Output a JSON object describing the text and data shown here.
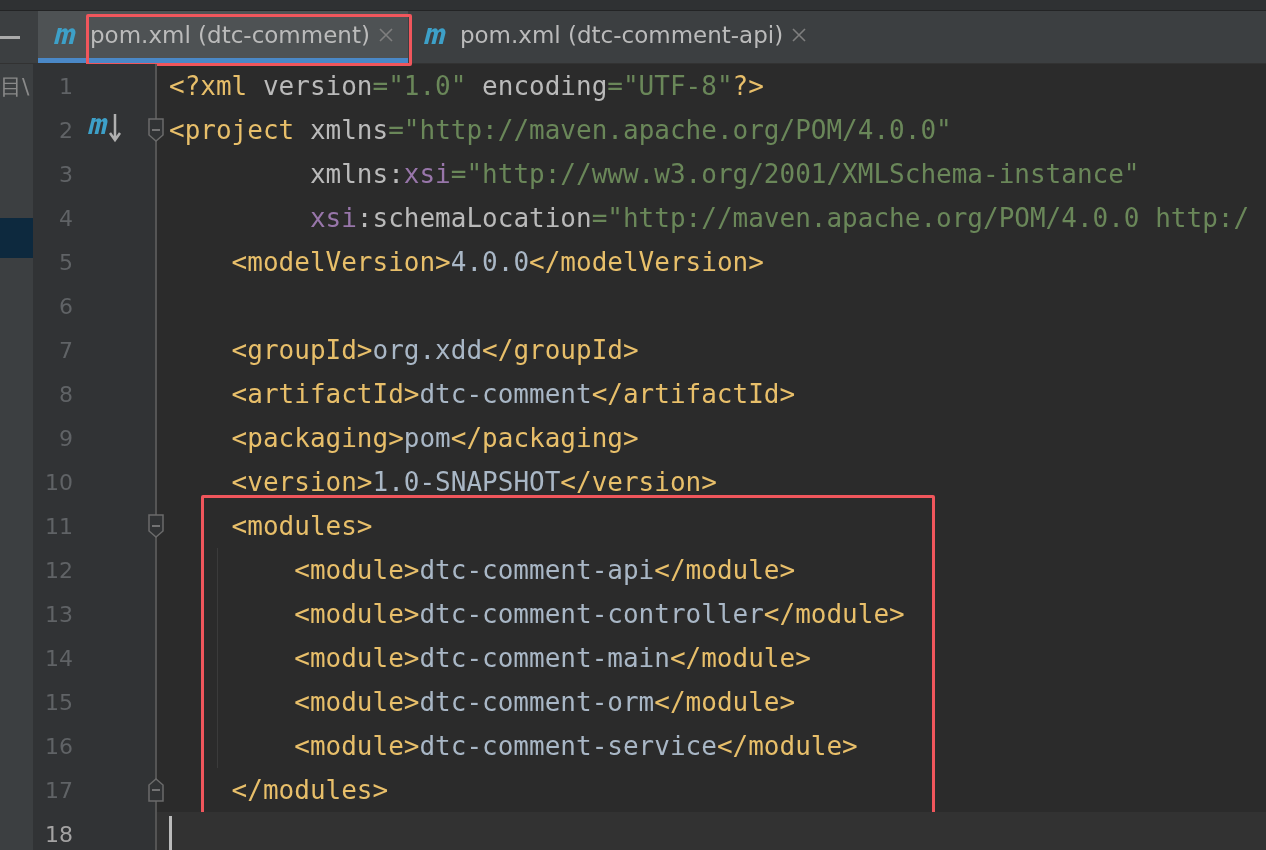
{
  "sidebar": {
    "label": "目\\"
  },
  "tabs": [
    {
      "label": "pom.xml (dtc-comment)",
      "selected": true,
      "highlighted": true
    },
    {
      "label": "pom.xml (dtc-comment-api)",
      "selected": false,
      "highlighted": false
    }
  ],
  "editor": {
    "blocks": [
      {
        "highlighted": false,
        "lines": [
          {
            "number": "1",
            "current": false,
            "tokens": [
              {
                "t": "<?xml ",
                "kind": "tag"
              },
              {
                "t": "version",
                "kind": "attr"
              },
              {
                "t": "=\"1.0\" ",
                "kind": "value"
              },
              {
                "t": "encoding",
                "kind": "attr"
              },
              {
                "t": "=\"UTF-8\"",
                "kind": "value"
              },
              {
                "t": "?>",
                "kind": "tag"
              }
            ]
          },
          {
            "number": "2",
            "current": false,
            "fold_start": true,
            "maven_marker": true,
            "tokens": [
              {
                "t": "<project ",
                "kind": "tag"
              },
              {
                "t": "xmlns",
                "kind": "attr"
              },
              {
                "t": "=\"http://maven.apache.org/POM/4.0.0\"",
                "kind": "value"
              }
            ]
          },
          {
            "number": "3",
            "current": false,
            "tokens": [
              {
                "t": "         xmlns:",
                "kind": "attr"
              },
              {
                "t": "xsi",
                "kind": "ns"
              },
              {
                "t": "=\"http://www.w3.org/2001/XMLSchema-instance\"",
                "kind": "value"
              }
            ]
          },
          {
            "number": "4",
            "current": false,
            "tokens": [
              {
                "t": "         xsi",
                "kind": "ns"
              },
              {
                "t": ":schemaLocation",
                "kind": "attr"
              },
              {
                "t": "=\"http://maven.apache.org/POM/4.0.0 http:/",
                "kind": "value"
              }
            ]
          },
          {
            "number": "5",
            "current": false,
            "tokens": [
              {
                "t": "    <modelVersion>",
                "kind": "tag"
              },
              {
                "t": "4.0.0",
                "kind": "text"
              },
              {
                "t": "</modelVersion>",
                "kind": "tag"
              }
            ]
          },
          {
            "number": "6",
            "current": false
          },
          {
            "number": "7",
            "current": false,
            "tokens": [
              {
                "t": "    <groupId>",
                "kind": "tag"
              },
              {
                "t": "org.xdd",
                "kind": "text"
              },
              {
                "t": "</groupId>",
                "kind": "tag"
              }
            ]
          },
          {
            "number": "8",
            "current": false,
            "tokens": [
              {
                "t": "    <artifactId>",
                "kind": "tag"
              },
              {
                "t": "dtc-comment",
                "kind": "text"
              },
              {
                "t": "</artifactId>",
                "kind": "tag"
              }
            ]
          },
          {
            "number": "9",
            "current": false,
            "tokens": [
              {
                "t": "    <packaging>",
                "kind": "tag"
              },
              {
                "t": "pom",
                "kind": "text"
              },
              {
                "t": "</packaging>",
                "kind": "tag"
              }
            ]
          },
          {
            "number": "10",
            "current": false,
            "tokens": [
              {
                "t": "    <version>",
                "kind": "tag"
              },
              {
                "t": "1.0-SNAPSHOT",
                "kind": "text"
              },
              {
                "t": "</version>",
                "kind": "tag"
              }
            ]
          }
        ]
      },
      {
        "highlighted": true,
        "lines": [
          {
            "number": "11",
            "current": false,
            "fold_start": true,
            "tokens": [
              {
                "t": "    <modules>",
                "kind": "tag"
              }
            ]
          },
          {
            "number": "12",
            "current": false,
            "guide": true,
            "tokens": [
              {
                "t": "        <module>",
                "kind": "tag"
              },
              {
                "t": "dtc-comment-api",
                "kind": "text"
              },
              {
                "t": "</module>",
                "kind": "tag"
              }
            ]
          },
          {
            "number": "13",
            "current": false,
            "guide": true,
            "tokens": [
              {
                "t": "        <module>",
                "kind": "tag"
              },
              {
                "t": "dtc-comment-controller",
                "kind": "text"
              },
              {
                "t": "</module>",
                "kind": "tag"
              }
            ]
          },
          {
            "number": "14",
            "current": false,
            "guide": true,
            "tokens": [
              {
                "t": "        <module>",
                "kind": "tag"
              },
              {
                "t": "dtc-comment-main",
                "kind": "text"
              },
              {
                "t": "</module>",
                "kind": "tag"
              }
            ]
          },
          {
            "number": "15",
            "current": false,
            "guide": true,
            "tokens": [
              {
                "t": "        <module>",
                "kind": "tag"
              },
              {
                "t": "dtc-comment-orm",
                "kind": "text"
              },
              {
                "t": "</module>",
                "kind": "tag"
              }
            ]
          },
          {
            "number": "16",
            "current": false,
            "guide": true,
            "tokens": [
              {
                "t": "        <module>",
                "kind": "tag"
              },
              {
                "t": "dtc-comment-service",
                "kind": "text"
              },
              {
                "t": "</module>",
                "kind": "tag"
              }
            ]
          },
          {
            "number": "17",
            "current": false,
            "fold_end": true,
            "tokens": [
              {
                "t": "    </modules>",
                "kind": "tag"
              }
            ]
          }
        ]
      },
      {
        "highlighted": false,
        "lines": [
          {
            "number": "18",
            "current": true
          }
        ]
      }
    ]
  }
}
